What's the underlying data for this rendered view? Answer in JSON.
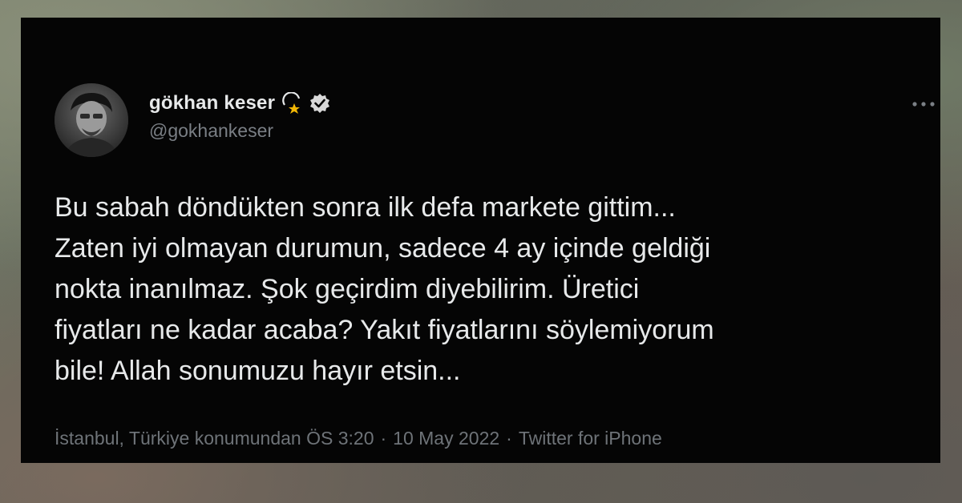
{
  "tweet": {
    "display_name": "gökhan keser",
    "handle": "@gokhankeser",
    "text_lines": [
      "Bu sabah döndükten sonra ilk defa markete gittim...",
      "Zaten iyi olmayan durumun, sadece 4 ay içinde geldiği",
      "nokta inanılmaz. Şok geçirdim diyebilirim. Üretici",
      "fiyatları ne kadar acaba? Yakıt fiyatlarını söylemiyorum",
      "bile! Allah sonumuzu hayır etsin..."
    ],
    "location": "İstanbul, Türkiye konumundan",
    "time": "ÖS 3:20",
    "date": "10 May 2022",
    "source": "Twitter for iPhone",
    "separator": "·"
  },
  "icons": {
    "avatar": "profile-photo",
    "emoji": "dizzy-star-emoji",
    "verified": "verified-badge",
    "more": "more-horizontal"
  },
  "colors": {
    "card_background": "#050505",
    "primary_text": "#e7e9ea",
    "secondary_text": "#7a7f85",
    "emoji_star": "#f2b705"
  }
}
